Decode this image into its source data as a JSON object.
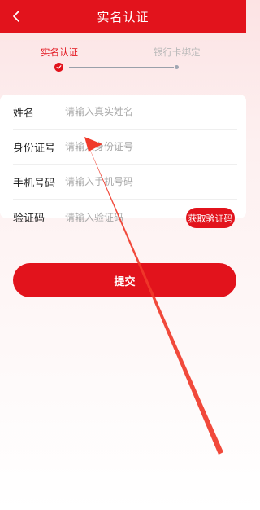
{
  "header": {
    "title": "实名认证",
    "back_icon": "chevron-left-icon"
  },
  "steps": [
    {
      "label": "实名认证",
      "status": "done",
      "color": "#e2131c"
    },
    {
      "label": "银行卡绑定",
      "status": "todo",
      "color": "#b9b9b9"
    }
  ],
  "form": {
    "fields": [
      {
        "label": "姓名",
        "placeholder": "请输入真实姓名",
        "value": ""
      },
      {
        "label": "身份证号",
        "placeholder": "请输入身份证号",
        "value": ""
      },
      {
        "label": "手机号码",
        "placeholder": "请输入手机号码",
        "value": ""
      },
      {
        "label": "验证码",
        "placeholder": "请输入验证码",
        "value": ""
      }
    ],
    "get_code_label": "获取验证码"
  },
  "submit_label": "提交",
  "colors": {
    "accent": "#e2131c",
    "annotation_arrow": "#f03a2a"
  }
}
